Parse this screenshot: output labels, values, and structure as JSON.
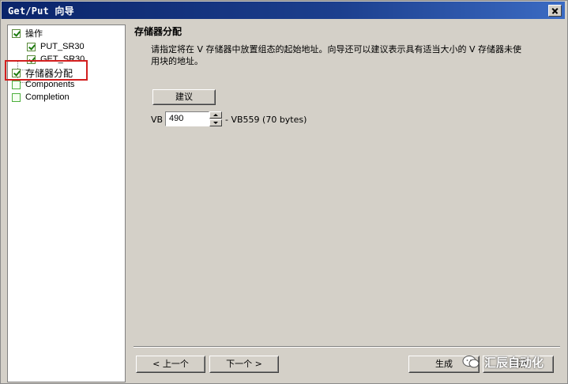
{
  "window": {
    "title": "Get/Put 向导"
  },
  "tree": {
    "items": [
      {
        "label": "操作",
        "checked": true
      },
      {
        "label": "PUT_SR30",
        "checked": true
      },
      {
        "label": "GET_SR30",
        "checked": true
      },
      {
        "label": "存储器分配",
        "checked": true,
        "selected": true
      },
      {
        "label": "Components",
        "checked": false
      },
      {
        "label": "Completion",
        "checked": false
      }
    ]
  },
  "main": {
    "heading": "存储器分配",
    "description": "请指定将在 V 存储器中放置组态的起始地址。向导还可以建议表示具有适当大小的 V 存储器未使用块的地址。",
    "suggest_button": "建议",
    "vb_label": "VB",
    "vb_value": "490",
    "range_text": "- VB559 (70 bytes)"
  },
  "footer": {
    "prev_button": "< 上一个",
    "next_button": "下一个 >",
    "generate_button": "生成",
    "cancel_button": "取消"
  },
  "watermark": {
    "text": "汇辰自动化"
  },
  "colors": {
    "titlebar": "#0a246a",
    "dialog_bg": "#d4d0c8",
    "highlight": "#d21f1f"
  }
}
